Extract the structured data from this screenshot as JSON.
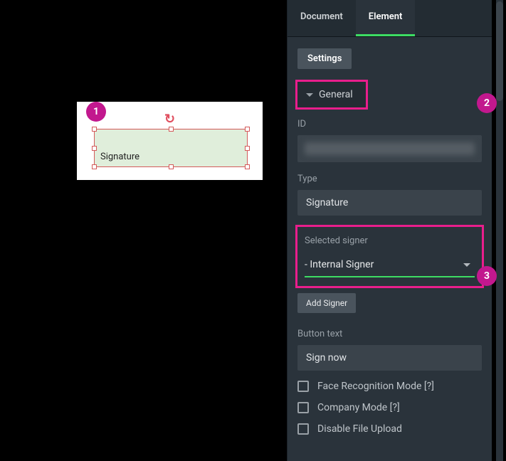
{
  "canvas": {
    "element_label": "Signature"
  },
  "tabs": {
    "document": "Document",
    "element": "Element"
  },
  "panel": {
    "settings_btn": "Settings",
    "section_general": "General",
    "id_label": "ID",
    "type_label": "Type",
    "type_value": "Signature",
    "selected_signer_label": "Selected signer",
    "selected_signer_value": "- Internal Signer",
    "add_signer_btn": "Add Signer",
    "button_text_label": "Button text",
    "button_text_value": "Sign now",
    "checkboxes": {
      "face": "Face Recognition Mode [?]",
      "company": "Company Mode [?]",
      "disable_upload": "Disable File Upload"
    }
  },
  "badges": {
    "b1": "1",
    "b2": "2",
    "b3": "3"
  }
}
